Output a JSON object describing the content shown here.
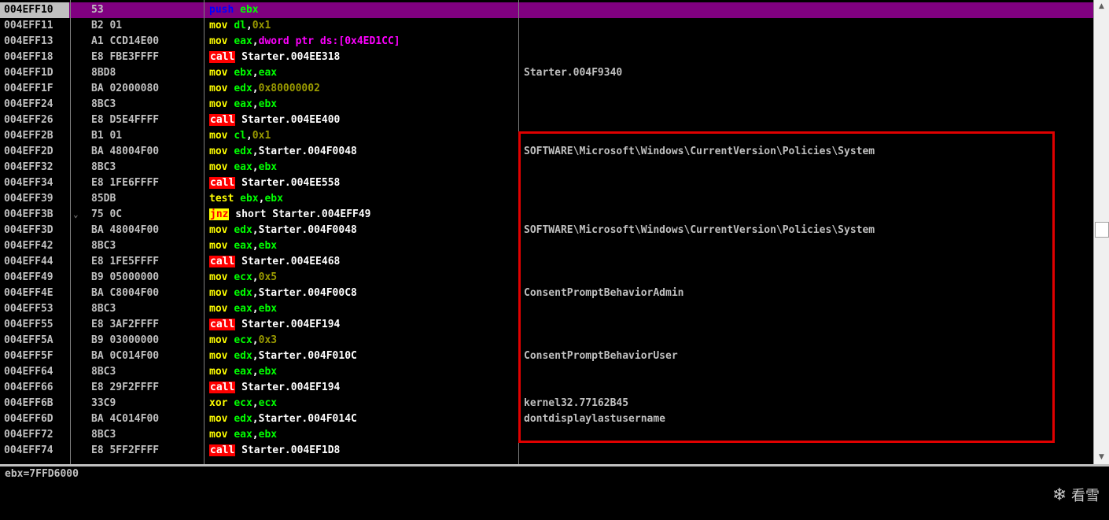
{
  "rows": [
    {
      "addr": "004EFF10",
      "hex": "53",
      "asm": [
        {
          "c": "push",
          "k": "push"
        },
        {
          "c": " ",
          "k": "plain"
        },
        {
          "c": "ebx",
          "k": "reg"
        }
      ],
      "comment": "",
      "selected": true
    },
    {
      "addr": "004EFF11",
      "hex": "B2 01",
      "asm": [
        {
          "c": "mov",
          "k": "mov"
        },
        {
          "c": " ",
          "k": "plain"
        },
        {
          "c": "dl",
          "k": "reg"
        },
        {
          "c": ",",
          "k": "plain"
        },
        {
          "c": "0x1",
          "k": "imm"
        }
      ],
      "comment": ""
    },
    {
      "addr": "004EFF13",
      "hex": "A1 CCD14E00",
      "asm": [
        {
          "c": "mov",
          "k": "mov"
        },
        {
          "c": " ",
          "k": "plain"
        },
        {
          "c": "eax",
          "k": "reg"
        },
        {
          "c": ",",
          "k": "plain"
        },
        {
          "c": "dword ptr ds:[0x4ED1CC]",
          "k": "mem"
        }
      ],
      "comment": ""
    },
    {
      "addr": "004EFF18",
      "hex": "E8 FBE3FFFF",
      "asm": [
        {
          "c": "call",
          "k": "call"
        },
        {
          "c": " Starter.004EE318",
          "k": "plain"
        }
      ],
      "comment": ""
    },
    {
      "addr": "004EFF1D",
      "hex": "8BD8",
      "asm": [
        {
          "c": "mov",
          "k": "mov"
        },
        {
          "c": " ",
          "k": "plain"
        },
        {
          "c": "ebx",
          "k": "reg"
        },
        {
          "c": ",",
          "k": "plain"
        },
        {
          "c": "eax",
          "k": "reg"
        }
      ],
      "comment": "Starter.004F9340"
    },
    {
      "addr": "004EFF1F",
      "hex": "BA 02000080",
      "asm": [
        {
          "c": "mov",
          "k": "mov"
        },
        {
          "c": " ",
          "k": "plain"
        },
        {
          "c": "edx",
          "k": "reg"
        },
        {
          "c": ",",
          "k": "plain"
        },
        {
          "c": "0x80000002",
          "k": "imm"
        }
      ],
      "comment": ""
    },
    {
      "addr": "004EFF24",
      "hex": "8BC3",
      "asm": [
        {
          "c": "mov",
          "k": "mov"
        },
        {
          "c": " ",
          "k": "plain"
        },
        {
          "c": "eax",
          "k": "reg"
        },
        {
          "c": ",",
          "k": "plain"
        },
        {
          "c": "ebx",
          "k": "reg"
        }
      ],
      "comment": ""
    },
    {
      "addr": "004EFF26",
      "hex": "E8 D5E4FFFF",
      "asm": [
        {
          "c": "call",
          "k": "call"
        },
        {
          "c": " Starter.004EE400",
          "k": "plain"
        }
      ],
      "comment": ""
    },
    {
      "addr": "004EFF2B",
      "hex": "B1 01",
      "asm": [
        {
          "c": "mov",
          "k": "mov"
        },
        {
          "c": " ",
          "k": "plain"
        },
        {
          "c": "cl",
          "k": "reg"
        },
        {
          "c": ",",
          "k": "plain"
        },
        {
          "c": "0x1",
          "k": "imm"
        }
      ],
      "comment": ""
    },
    {
      "addr": "004EFF2D",
      "hex": "BA 48004F00",
      "asm": [
        {
          "c": "mov",
          "k": "mov"
        },
        {
          "c": " ",
          "k": "plain"
        },
        {
          "c": "edx",
          "k": "reg"
        },
        {
          "c": ",Starter.004F0048",
          "k": "plain"
        }
      ],
      "comment": "SOFTWARE\\Microsoft\\Windows\\CurrentVersion\\Policies\\System"
    },
    {
      "addr": "004EFF32",
      "hex": "8BC3",
      "asm": [
        {
          "c": "mov",
          "k": "mov"
        },
        {
          "c": " ",
          "k": "plain"
        },
        {
          "c": "eax",
          "k": "reg"
        },
        {
          "c": ",",
          "k": "plain"
        },
        {
          "c": "ebx",
          "k": "reg"
        }
      ],
      "comment": ""
    },
    {
      "addr": "004EFF34",
      "hex": "E8 1FE6FFFF",
      "asm": [
        {
          "c": "call",
          "k": "call"
        },
        {
          "c": " Starter.004EE558",
          "k": "plain"
        }
      ],
      "comment": ""
    },
    {
      "addr": "004EFF39",
      "hex": "85DB",
      "asm": [
        {
          "c": "test",
          "k": "test"
        },
        {
          "c": " ",
          "k": "plain"
        },
        {
          "c": "ebx",
          "k": "reg"
        },
        {
          "c": ",",
          "k": "plain"
        },
        {
          "c": "ebx",
          "k": "reg"
        }
      ],
      "comment": ""
    },
    {
      "addr": "004EFF3B",
      "mark": "⌄",
      "hex": "75 0C",
      "asm": [
        {
          "c": "jnz",
          "k": "jnz"
        },
        {
          "c": " short Starter.004EFF49",
          "k": "plain"
        }
      ],
      "comment": ""
    },
    {
      "addr": "004EFF3D",
      "hex": "BA 48004F00",
      "asm": [
        {
          "c": "mov",
          "k": "mov"
        },
        {
          "c": " ",
          "k": "plain"
        },
        {
          "c": "edx",
          "k": "reg"
        },
        {
          "c": ",Starter.004F0048",
          "k": "plain"
        }
      ],
      "comment": "SOFTWARE\\Microsoft\\Windows\\CurrentVersion\\Policies\\System"
    },
    {
      "addr": "004EFF42",
      "hex": "8BC3",
      "asm": [
        {
          "c": "mov",
          "k": "mov"
        },
        {
          "c": " ",
          "k": "plain"
        },
        {
          "c": "eax",
          "k": "reg"
        },
        {
          "c": ",",
          "k": "plain"
        },
        {
          "c": "ebx",
          "k": "reg"
        }
      ],
      "comment": ""
    },
    {
      "addr": "004EFF44",
      "hex": "E8 1FE5FFFF",
      "asm": [
        {
          "c": "call",
          "k": "call"
        },
        {
          "c": " Starter.004EE468",
          "k": "plain"
        }
      ],
      "comment": ""
    },
    {
      "addr": "004EFF49",
      "hex": "B9 05000000",
      "asm": [
        {
          "c": "mov",
          "k": "mov"
        },
        {
          "c": " ",
          "k": "plain"
        },
        {
          "c": "ecx",
          "k": "reg"
        },
        {
          "c": ",",
          "k": "plain"
        },
        {
          "c": "0x5",
          "k": "imm"
        }
      ],
      "comment": ""
    },
    {
      "addr": "004EFF4E",
      "hex": "BA C8004F00",
      "asm": [
        {
          "c": "mov",
          "k": "mov"
        },
        {
          "c": " ",
          "k": "plain"
        },
        {
          "c": "edx",
          "k": "reg"
        },
        {
          "c": ",Starter.004F00C8",
          "k": "plain"
        }
      ],
      "comment": "ConsentPromptBehaviorAdmin"
    },
    {
      "addr": "004EFF53",
      "hex": "8BC3",
      "asm": [
        {
          "c": "mov",
          "k": "mov"
        },
        {
          "c": " ",
          "k": "plain"
        },
        {
          "c": "eax",
          "k": "reg"
        },
        {
          "c": ",",
          "k": "plain"
        },
        {
          "c": "ebx",
          "k": "reg"
        }
      ],
      "comment": ""
    },
    {
      "addr": "004EFF55",
      "hex": "E8 3AF2FFFF",
      "asm": [
        {
          "c": "call",
          "k": "call"
        },
        {
          "c": " Starter.004EF194",
          "k": "plain"
        }
      ],
      "comment": ""
    },
    {
      "addr": "004EFF5A",
      "hex": "B9 03000000",
      "asm": [
        {
          "c": "mov",
          "k": "mov"
        },
        {
          "c": " ",
          "k": "plain"
        },
        {
          "c": "ecx",
          "k": "reg"
        },
        {
          "c": ",",
          "k": "plain"
        },
        {
          "c": "0x3",
          "k": "imm"
        }
      ],
      "comment": ""
    },
    {
      "addr": "004EFF5F",
      "hex": "BA 0C014F00",
      "asm": [
        {
          "c": "mov",
          "k": "mov"
        },
        {
          "c": " ",
          "k": "plain"
        },
        {
          "c": "edx",
          "k": "reg"
        },
        {
          "c": ",Starter.004F010C",
          "k": "plain"
        }
      ],
      "comment": "ConsentPromptBehaviorUser"
    },
    {
      "addr": "004EFF64",
      "hex": "8BC3",
      "asm": [
        {
          "c": "mov",
          "k": "mov"
        },
        {
          "c": " ",
          "k": "plain"
        },
        {
          "c": "eax",
          "k": "reg"
        },
        {
          "c": ",",
          "k": "plain"
        },
        {
          "c": "ebx",
          "k": "reg"
        }
      ],
      "comment": ""
    },
    {
      "addr": "004EFF66",
      "hex": "E8 29F2FFFF",
      "asm": [
        {
          "c": "call",
          "k": "call"
        },
        {
          "c": " Starter.004EF194",
          "k": "plain"
        }
      ],
      "comment": ""
    },
    {
      "addr": "004EFF6B",
      "hex": "33C9",
      "asm": [
        {
          "c": "xor",
          "k": "xor"
        },
        {
          "c": " ",
          "k": "plain"
        },
        {
          "c": "ecx",
          "k": "reg"
        },
        {
          "c": ",",
          "k": "plain"
        },
        {
          "c": "ecx",
          "k": "reg"
        }
      ],
      "comment": "kernel32.77162B45"
    },
    {
      "addr": "004EFF6D",
      "hex": "BA 4C014F00",
      "asm": [
        {
          "c": "mov",
          "k": "mov"
        },
        {
          "c": " ",
          "k": "plain"
        },
        {
          "c": "edx",
          "k": "reg"
        },
        {
          "c": ",Starter.004F014C",
          "k": "plain"
        }
      ],
      "comment": "dontdisplaylastusername"
    },
    {
      "addr": "004EFF72",
      "hex": "8BC3",
      "asm": [
        {
          "c": "mov",
          "k": "mov"
        },
        {
          "c": " ",
          "k": "plain"
        },
        {
          "c": "eax",
          "k": "reg"
        },
        {
          "c": ",",
          "k": "plain"
        },
        {
          "c": "ebx",
          "k": "reg"
        }
      ],
      "comment": ""
    },
    {
      "addr": "004EFF74",
      "hex": "E8 5FF2FFFF",
      "asm": [
        {
          "c": "call",
          "k": "call"
        },
        {
          "c": " Starter.004EF1D8",
          "k": "plain"
        }
      ],
      "comment": ""
    }
  ],
  "info": {
    "text": "ebx=7FFD6000"
  },
  "watermark": {
    "icon": "snowflake-icon",
    "text": "看雪"
  },
  "colors": {
    "selected_row": "#800080",
    "register": "#00ff00",
    "mnemonic": "#ffff00",
    "call_bg": "#ff0000",
    "immediate": "#9a9a00",
    "memory": "#ff00ff",
    "highlight_box": "#e00000"
  }
}
